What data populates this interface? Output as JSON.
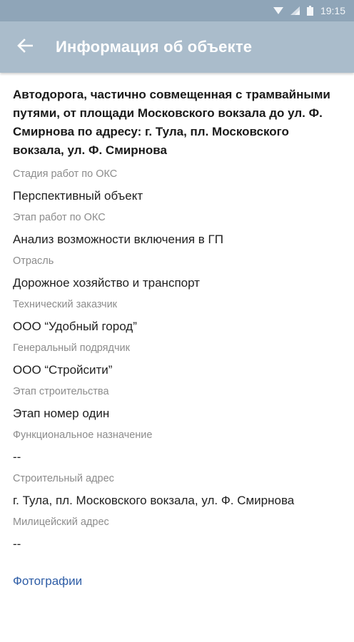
{
  "status_bar": {
    "time": "19:15",
    "icons": [
      "wifi-icon",
      "signal-icon",
      "battery-icon"
    ]
  },
  "app_bar": {
    "back_icon": "arrow-left-icon",
    "title": "Информация об объекте",
    "color": "#aabccb"
  },
  "object": {
    "title": "Автодорога, частично совмещенная с трамвайными путями, от площади Московского вокзала до ул. Ф. Смирнова по адресу: г. Тула, пл. Московского вокзала, ул. Ф. Смирнова"
  },
  "fields": [
    {
      "label": "Стадия работ по ОКС",
      "value": "Перспективный объект"
    },
    {
      "label": "Этап работ по ОКС",
      "value": "Анализ возможности включения в ГП"
    },
    {
      "label": "Отрасль",
      "value": "Дорожное хозяйство и транспорт"
    },
    {
      "label": "Технический заказчик",
      "value": "ООО “Удобный город”"
    },
    {
      "label": "Генеральный подрядчик",
      "value": "ООО “Стройсити”"
    },
    {
      "label": "Этап строительства",
      "value": "Этап номер один"
    },
    {
      "label": "Функциональное назначение",
      "value": "--"
    },
    {
      "label": "Строительный адрес",
      "value": "г. Тула, пл. Московского вокзала, ул. Ф. Смирнова"
    },
    {
      "label": "Милицейский адрес",
      "value": "--"
    }
  ],
  "photos_link": "Фотографии",
  "colors": {
    "link": "#2e5da6",
    "label": "#8c8c8c"
  }
}
